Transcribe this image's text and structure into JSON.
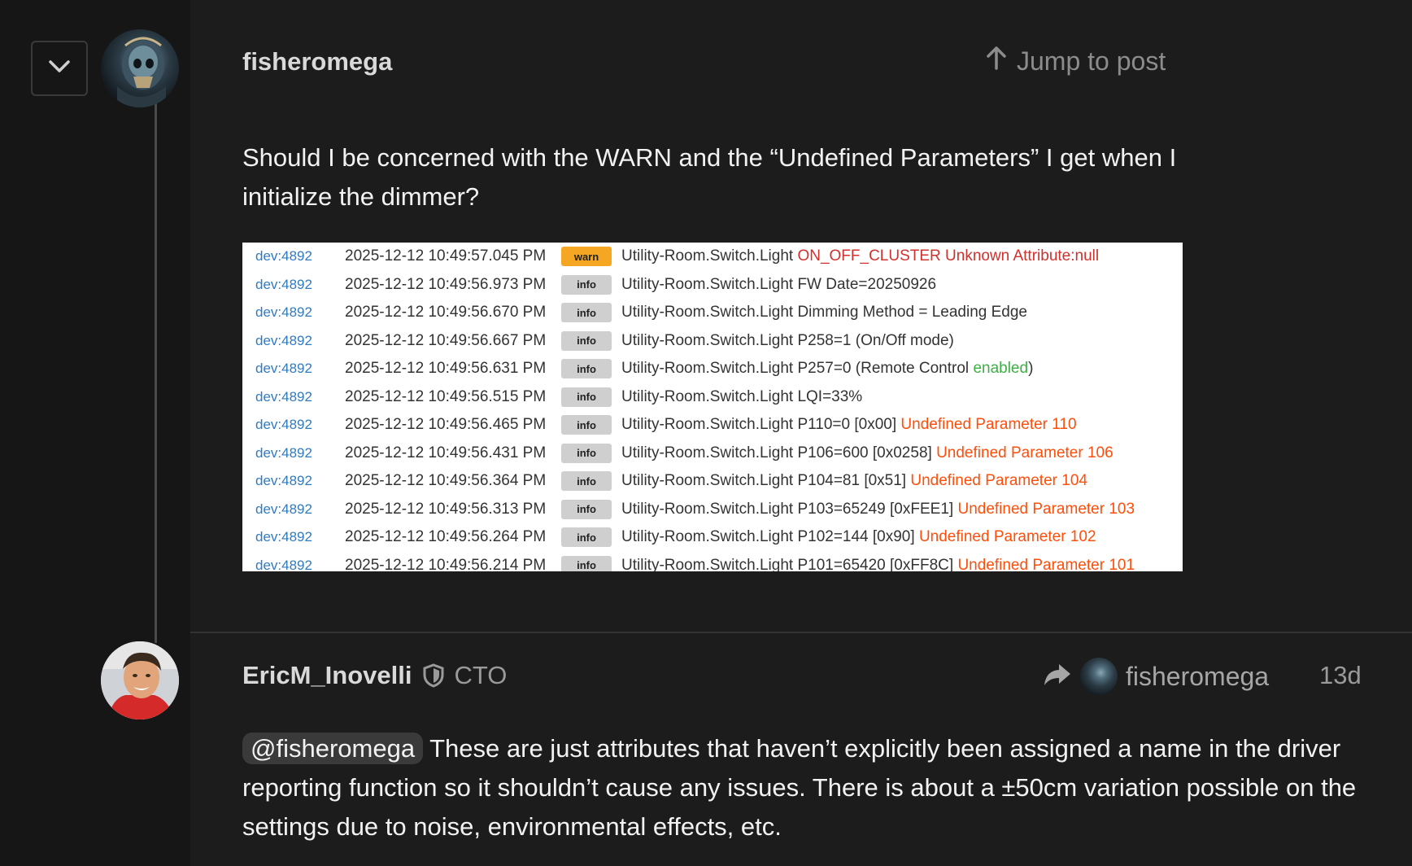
{
  "thread": {
    "collapse_icon": "chevron-down-icon"
  },
  "posts": [
    {
      "username": "fisheromega",
      "avatar_icon": "skull-helmet-avatar",
      "jump_to_post": "Jump to post",
      "body": "Should I be concerned with the WARN and the “Undefined Parameters” I get when I initialize the dimmer?",
      "log": [
        {
          "dev": "dev:4892",
          "time": "2025-12-12 10:49:57.045 PM",
          "level": "warn",
          "msg": "Utility-Room.Switch.Light ",
          "hl": "ON_OFF_CLUSTER Unknown Attribute:null",
          "hl_color": "red",
          "tail": ""
        },
        {
          "dev": "dev:4892",
          "time": "2025-12-12 10:49:56.973 PM",
          "level": "info",
          "msg": "Utility-Room.Switch.Light FW Date=20250926",
          "hl": "",
          "hl_color": "",
          "tail": ""
        },
        {
          "dev": "dev:4892",
          "time": "2025-12-12 10:49:56.670 PM",
          "level": "info",
          "msg": "Utility-Room.Switch.Light Dimming Method = Leading Edge",
          "hl": "",
          "hl_color": "",
          "tail": ""
        },
        {
          "dev": "dev:4892",
          "time": "2025-12-12 10:49:56.667 PM",
          "level": "info",
          "msg": "Utility-Room.Switch.Light P258=1 (On/Off mode)",
          "hl": "",
          "hl_color": "",
          "tail": ""
        },
        {
          "dev": "dev:4892",
          "time": "2025-12-12 10:49:56.631 PM",
          "level": "info",
          "msg": "Utility-Room.Switch.Light P257=0 (Remote Control ",
          "hl": "enabled",
          "hl_color": "green",
          "tail": ")"
        },
        {
          "dev": "dev:4892",
          "time": "2025-12-12 10:49:56.515 PM",
          "level": "info",
          "msg": "Utility-Room.Switch.Light LQI=33%",
          "hl": "",
          "hl_color": "",
          "tail": ""
        },
        {
          "dev": "dev:4892",
          "time": "2025-12-12 10:49:56.465 PM",
          "level": "info",
          "msg": "Utility-Room.Switch.Light P110=0 [0x00] ",
          "hl": "Undefined Parameter 110",
          "hl_color": "orange",
          "tail": ""
        },
        {
          "dev": "dev:4892",
          "time": "2025-12-12 10:49:56.431 PM",
          "level": "info",
          "msg": "Utility-Room.Switch.Light P106=600 [0x0258] ",
          "hl": "Undefined Parameter 106",
          "hl_color": "orange",
          "tail": ""
        },
        {
          "dev": "dev:4892",
          "time": "2025-12-12 10:49:56.364 PM",
          "level": "info",
          "msg": "Utility-Room.Switch.Light P104=81 [0x51] ",
          "hl": "Undefined Parameter 104",
          "hl_color": "orange",
          "tail": ""
        },
        {
          "dev": "dev:4892",
          "time": "2025-12-12 10:49:56.313 PM",
          "level": "info",
          "msg": "Utility-Room.Switch.Light P103=65249 [0xFEE1] ",
          "hl": "Undefined Parameter 103",
          "hl_color": "orange",
          "tail": ""
        },
        {
          "dev": "dev:4892",
          "time": "2025-12-12 10:49:56.264 PM",
          "level": "info",
          "msg": "Utility-Room.Switch.Light P102=144 [0x90] ",
          "hl": "Undefined Parameter 102",
          "hl_color": "orange",
          "tail": ""
        },
        {
          "dev": "dev:4892",
          "time": "2025-12-12 10:49:56.214 PM",
          "level": "info",
          "msg": "Utility-Room.Switch.Light P101=65420 [0xFF8C] ",
          "hl": "Undefined Parameter 101",
          "hl_color": "orange",
          "tail": ""
        }
      ]
    },
    {
      "username": "EricM_Inovelli",
      "avatar_icon": "user-photo-avatar",
      "moderator_icon": "shield-icon",
      "user_title": "CTO",
      "reply_icon": "reply-arrow-icon",
      "reply_to_username": "fisheromega",
      "date": "13d",
      "mention": "@fisheromega",
      "body": " These are just attributes that haven’t explicitly been assigned a name in the driver reporting function so it shouldn’t cause any issues. There is about a ±50cm variation possible on the settings due to noise, environmental effects, etc."
    }
  ],
  "colors": {
    "background": "#1c1c1c",
    "gutter": "#161616",
    "warn_badge": "#f5a623",
    "info_badge": "#cfcfcf",
    "log_red": "#d0312d",
    "log_orange": "#ff4d0a",
    "log_green": "#3cb043",
    "dev_link": "#2f7bc1"
  }
}
